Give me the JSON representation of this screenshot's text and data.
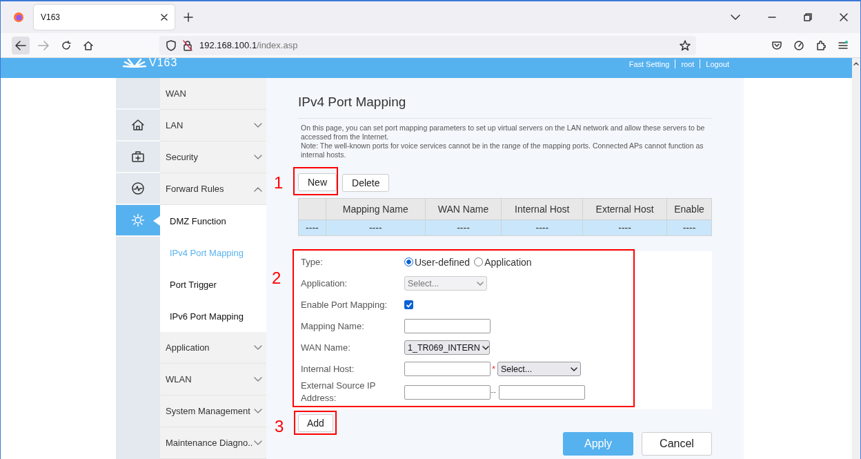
{
  "browser": {
    "tab": {
      "title": "V163",
      "selected": true
    },
    "address": {
      "host": "192.168.100.1",
      "path": "/index.asp"
    }
  },
  "header": {
    "logo_text": "V163",
    "links": [
      "Fast Setting",
      "root",
      "Logout"
    ]
  },
  "sidebar_icons": [
    {
      "selected": false
    },
    {
      "selected": false
    },
    {
      "selected": false
    },
    {
      "selected": true
    }
  ],
  "menu": [
    {
      "label": "WAN",
      "kind": "item"
    },
    {
      "label": "LAN",
      "kind": "group",
      "expanded": false
    },
    {
      "label": "Security",
      "kind": "group",
      "expanded": false
    },
    {
      "label": "Forward Rules",
      "kind": "group",
      "expanded": true,
      "children": [
        {
          "label": "DMZ Function",
          "selected": false
        },
        {
          "label": "IPv4 Port Mapping",
          "selected": true
        },
        {
          "label": "Port Trigger",
          "selected": false
        },
        {
          "label": "IPv6 Port Mapping",
          "selected": false
        }
      ]
    },
    {
      "label": "Application",
      "kind": "group",
      "expanded": false
    },
    {
      "label": "WLAN",
      "kind": "group",
      "expanded": false
    },
    {
      "label": "System Management",
      "kind": "group",
      "expanded": false
    },
    {
      "label": "Maintenance Diagno..",
      "kind": "group",
      "expanded": false
    }
  ],
  "page": {
    "title": "IPv4 Port Mapping",
    "description": [
      "On this page, you can set port mapping parameters to set up virtual servers on the LAN network and allow these servers to be accessed from the Internet.",
      "Note: The well-known ports for voice services cannot be in the range of the mapping ports. Connected APs cannot function as internal hosts."
    ],
    "buttons": [
      "New",
      "Delete"
    ],
    "table": {
      "columns": [
        "",
        "Mapping Name",
        "WAN Name",
        "Internal Host",
        "External Host",
        "Enable"
      ],
      "rows": [
        [
          "----",
          "----",
          "----",
          "----",
          "----",
          "----"
        ]
      ]
    },
    "form": [
      {
        "label": "Type:",
        "kind": "radio",
        "options": [
          {
            "label": "User-defined",
            "selected": true
          },
          {
            "label": "Application",
            "selected": false
          }
        ]
      },
      {
        "label": "Application:",
        "kind": "select",
        "value": "Select...",
        "disabled": true
      },
      {
        "label": "Enable Port Mapping:",
        "kind": "checkbox",
        "checked": true
      },
      {
        "label": "Mapping Name:",
        "kind": "text"
      },
      {
        "label": "WAN Name:",
        "kind": "select",
        "value": "1_TR069_INTERN",
        "disabled": false
      },
      {
        "label": "Internal Host:",
        "kind": "host",
        "required_mark": "*",
        "select_value": "Select..."
      },
      {
        "label": "External Source IP Address:",
        "kind": "range",
        "separator": "--"
      }
    ],
    "add_button": "Add",
    "actions": [
      {
        "label": "Apply",
        "kind": "primary"
      },
      {
        "label": "Cancel",
        "kind": "secondary"
      }
    ]
  },
  "annotations": [
    "1",
    "2",
    "3"
  ]
}
